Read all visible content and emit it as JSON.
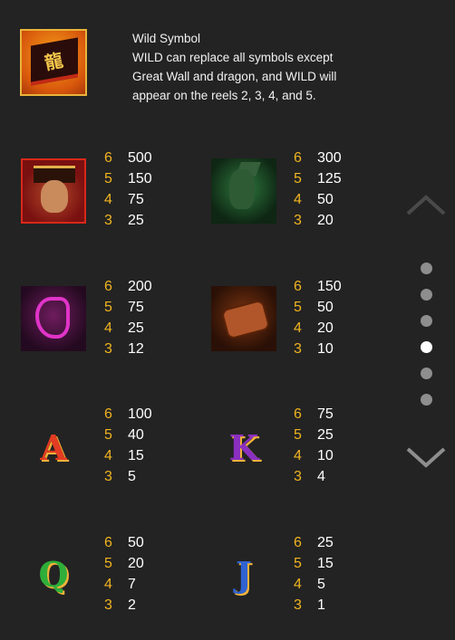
{
  "wild": {
    "title": "Wild Symbol",
    "description": "WILD can replace all symbols except Great Wall and dragon, and WILD will appear on the reels 2, 3, 4, and 5."
  },
  "symbols": [
    {
      "name": "emperor",
      "pays": [
        {
          "count": "6",
          "value": "500"
        },
        {
          "count": "5",
          "value": "150"
        },
        {
          "count": "4",
          "value": "75"
        },
        {
          "count": "3",
          "value": "25"
        }
      ]
    },
    {
      "name": "terracotta-warrior",
      "pays": [
        {
          "count": "6",
          "value": "300"
        },
        {
          "count": "5",
          "value": "125"
        },
        {
          "count": "4",
          "value": "50"
        },
        {
          "count": "3",
          "value": "20"
        }
      ]
    },
    {
      "name": "horse",
      "pays": [
        {
          "count": "6",
          "value": "200"
        },
        {
          "count": "5",
          "value": "75"
        },
        {
          "count": "4",
          "value": "25"
        },
        {
          "count": "3",
          "value": "12"
        }
      ]
    },
    {
      "name": "scroll",
      "pays": [
        {
          "count": "6",
          "value": "150"
        },
        {
          "count": "5",
          "value": "50"
        },
        {
          "count": "4",
          "value": "20"
        },
        {
          "count": "3",
          "value": "10"
        }
      ]
    },
    {
      "name": "letter-a",
      "glyph": "A",
      "pays": [
        {
          "count": "6",
          "value": "100"
        },
        {
          "count": "5",
          "value": "40"
        },
        {
          "count": "4",
          "value": "15"
        },
        {
          "count": "3",
          "value": "5"
        }
      ]
    },
    {
      "name": "letter-k",
      "glyph": "K",
      "pays": [
        {
          "count": "6",
          "value": "75"
        },
        {
          "count": "5",
          "value": "25"
        },
        {
          "count": "4",
          "value": "10"
        },
        {
          "count": "3",
          "value": "4"
        }
      ]
    },
    {
      "name": "letter-q",
      "glyph": "Q",
      "pays": [
        {
          "count": "6",
          "value": "50"
        },
        {
          "count": "5",
          "value": "20"
        },
        {
          "count": "4",
          "value": "7"
        },
        {
          "count": "3",
          "value": "2"
        }
      ]
    },
    {
      "name": "letter-j",
      "glyph": "J",
      "pays": [
        {
          "count": "6",
          "value": "25"
        },
        {
          "count": "5",
          "value": "15"
        },
        {
          "count": "4",
          "value": "5"
        },
        {
          "count": "3",
          "value": "1"
        }
      ]
    }
  ],
  "pagination": {
    "pages": 6,
    "active_index": 3
  },
  "icons": {
    "prev": "chevron-up-icon",
    "next": "chevron-down-icon"
  }
}
